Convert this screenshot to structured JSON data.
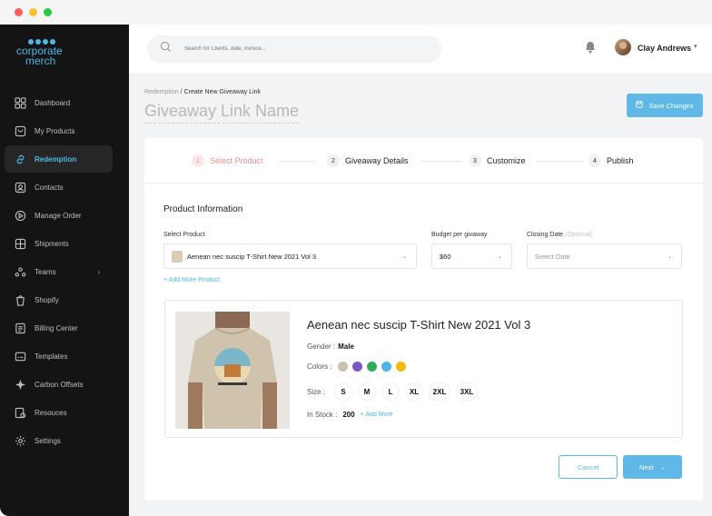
{
  "window": {
    "dots": [
      "#ff5f57",
      "#febc2e",
      "#28c840"
    ]
  },
  "logo": {
    "line1": "corporate",
    "line2": "merch"
  },
  "sidebar": {
    "items": [
      {
        "label": "Dashboard",
        "icon": "dashboard-icon"
      },
      {
        "label": "My Products",
        "icon": "products-icon"
      },
      {
        "label": "Redemption",
        "icon": "link-icon",
        "active": true
      },
      {
        "label": "Contacts",
        "icon": "contacts-icon"
      },
      {
        "label": "Manage Order",
        "icon": "order-icon"
      },
      {
        "label": "Shipments",
        "icon": "shipments-icon"
      },
      {
        "label": "Teams",
        "icon": "teams-icon",
        "chevron": true
      },
      {
        "label": "Shopify",
        "icon": "shopify-icon"
      },
      {
        "label": "Billing Center",
        "icon": "billing-icon"
      },
      {
        "label": "Templates",
        "icon": "templates-icon"
      },
      {
        "label": "Carbon Offsets",
        "icon": "leaf-icon"
      },
      {
        "label": "Resouces",
        "icon": "resources-icon"
      },
      {
        "label": "Settings",
        "icon": "gear-icon"
      }
    ]
  },
  "topbar": {
    "search_placeholder": "Search for Clients, date, invoice...",
    "user_name": "Clay Andrews"
  },
  "breadcrumb": {
    "parent": "Redemption",
    "separator": " / ",
    "current": "Create New Giveaway Link"
  },
  "page_title": "Giveaway Link Name",
  "save_button": "Save Changes",
  "steps": [
    {
      "num": "1",
      "label": "Select Product",
      "active": true
    },
    {
      "num": "2",
      "label": "Giveaway Details"
    },
    {
      "num": "3",
      "label": "Customize"
    },
    {
      "num": "4",
      "label": "Publish"
    }
  ],
  "form": {
    "section_title": "Product Information",
    "select_product_label": "Select Product",
    "select_product_value": "Aenean nec suscip T-Shirt New 2021 Vol 3",
    "budget_label": "Budget per givaway",
    "budget_value": "$60",
    "closing_label": "Closing Date",
    "closing_optional": "(Optional)",
    "closing_placeholder": "Select Date",
    "add_product": "+ Add More Product"
  },
  "product": {
    "name": "Aenean nec suscip T-Shirt New 2021 Vol 3",
    "gender_label": "Gender :",
    "gender_value": "Male",
    "colors_label": "Colors :",
    "colors": [
      "#cbbfae",
      "#7b57c6",
      "#2fae5a",
      "#4fb6e6",
      "#f5b914"
    ],
    "size_label": "Size :",
    "sizes": [
      "S",
      "M",
      "L",
      "XL",
      "2XL",
      "3XL"
    ],
    "stock_label": "In Stock :",
    "stock_value": "200",
    "add_more": "+ Add More"
  },
  "actions": {
    "cancel": "Cancel",
    "next": "Next"
  }
}
